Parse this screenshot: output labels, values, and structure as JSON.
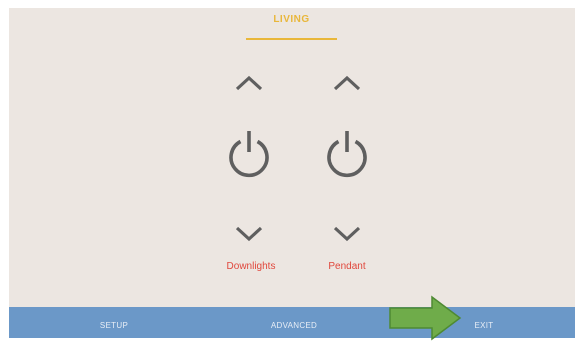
{
  "room": {
    "title": "LIVING"
  },
  "loads": [
    {
      "label": "Downlights",
      "up_icon": "chevron-up-icon",
      "power_icon": "power-icon",
      "down_icon": "chevron-down-icon"
    },
    {
      "label": "Pendant",
      "up_icon": "chevron-up-icon",
      "power_icon": "power-icon",
      "down_icon": "chevron-down-icon"
    }
  ],
  "bottom_bar": {
    "setup_label": "SETUP",
    "advanced_label": "ADVANCED",
    "exit_label": "EXIT"
  },
  "annotation": {
    "icon": "arrow-right-icon"
  },
  "colors": {
    "panel_background": "#ece6e1",
    "accent": "#e9b73a",
    "load_label": "#e0473c",
    "icon_gray": "#5f5f5f",
    "bottom_bar": "#6b98c8",
    "annotation_arrow": "#6fac4a"
  }
}
